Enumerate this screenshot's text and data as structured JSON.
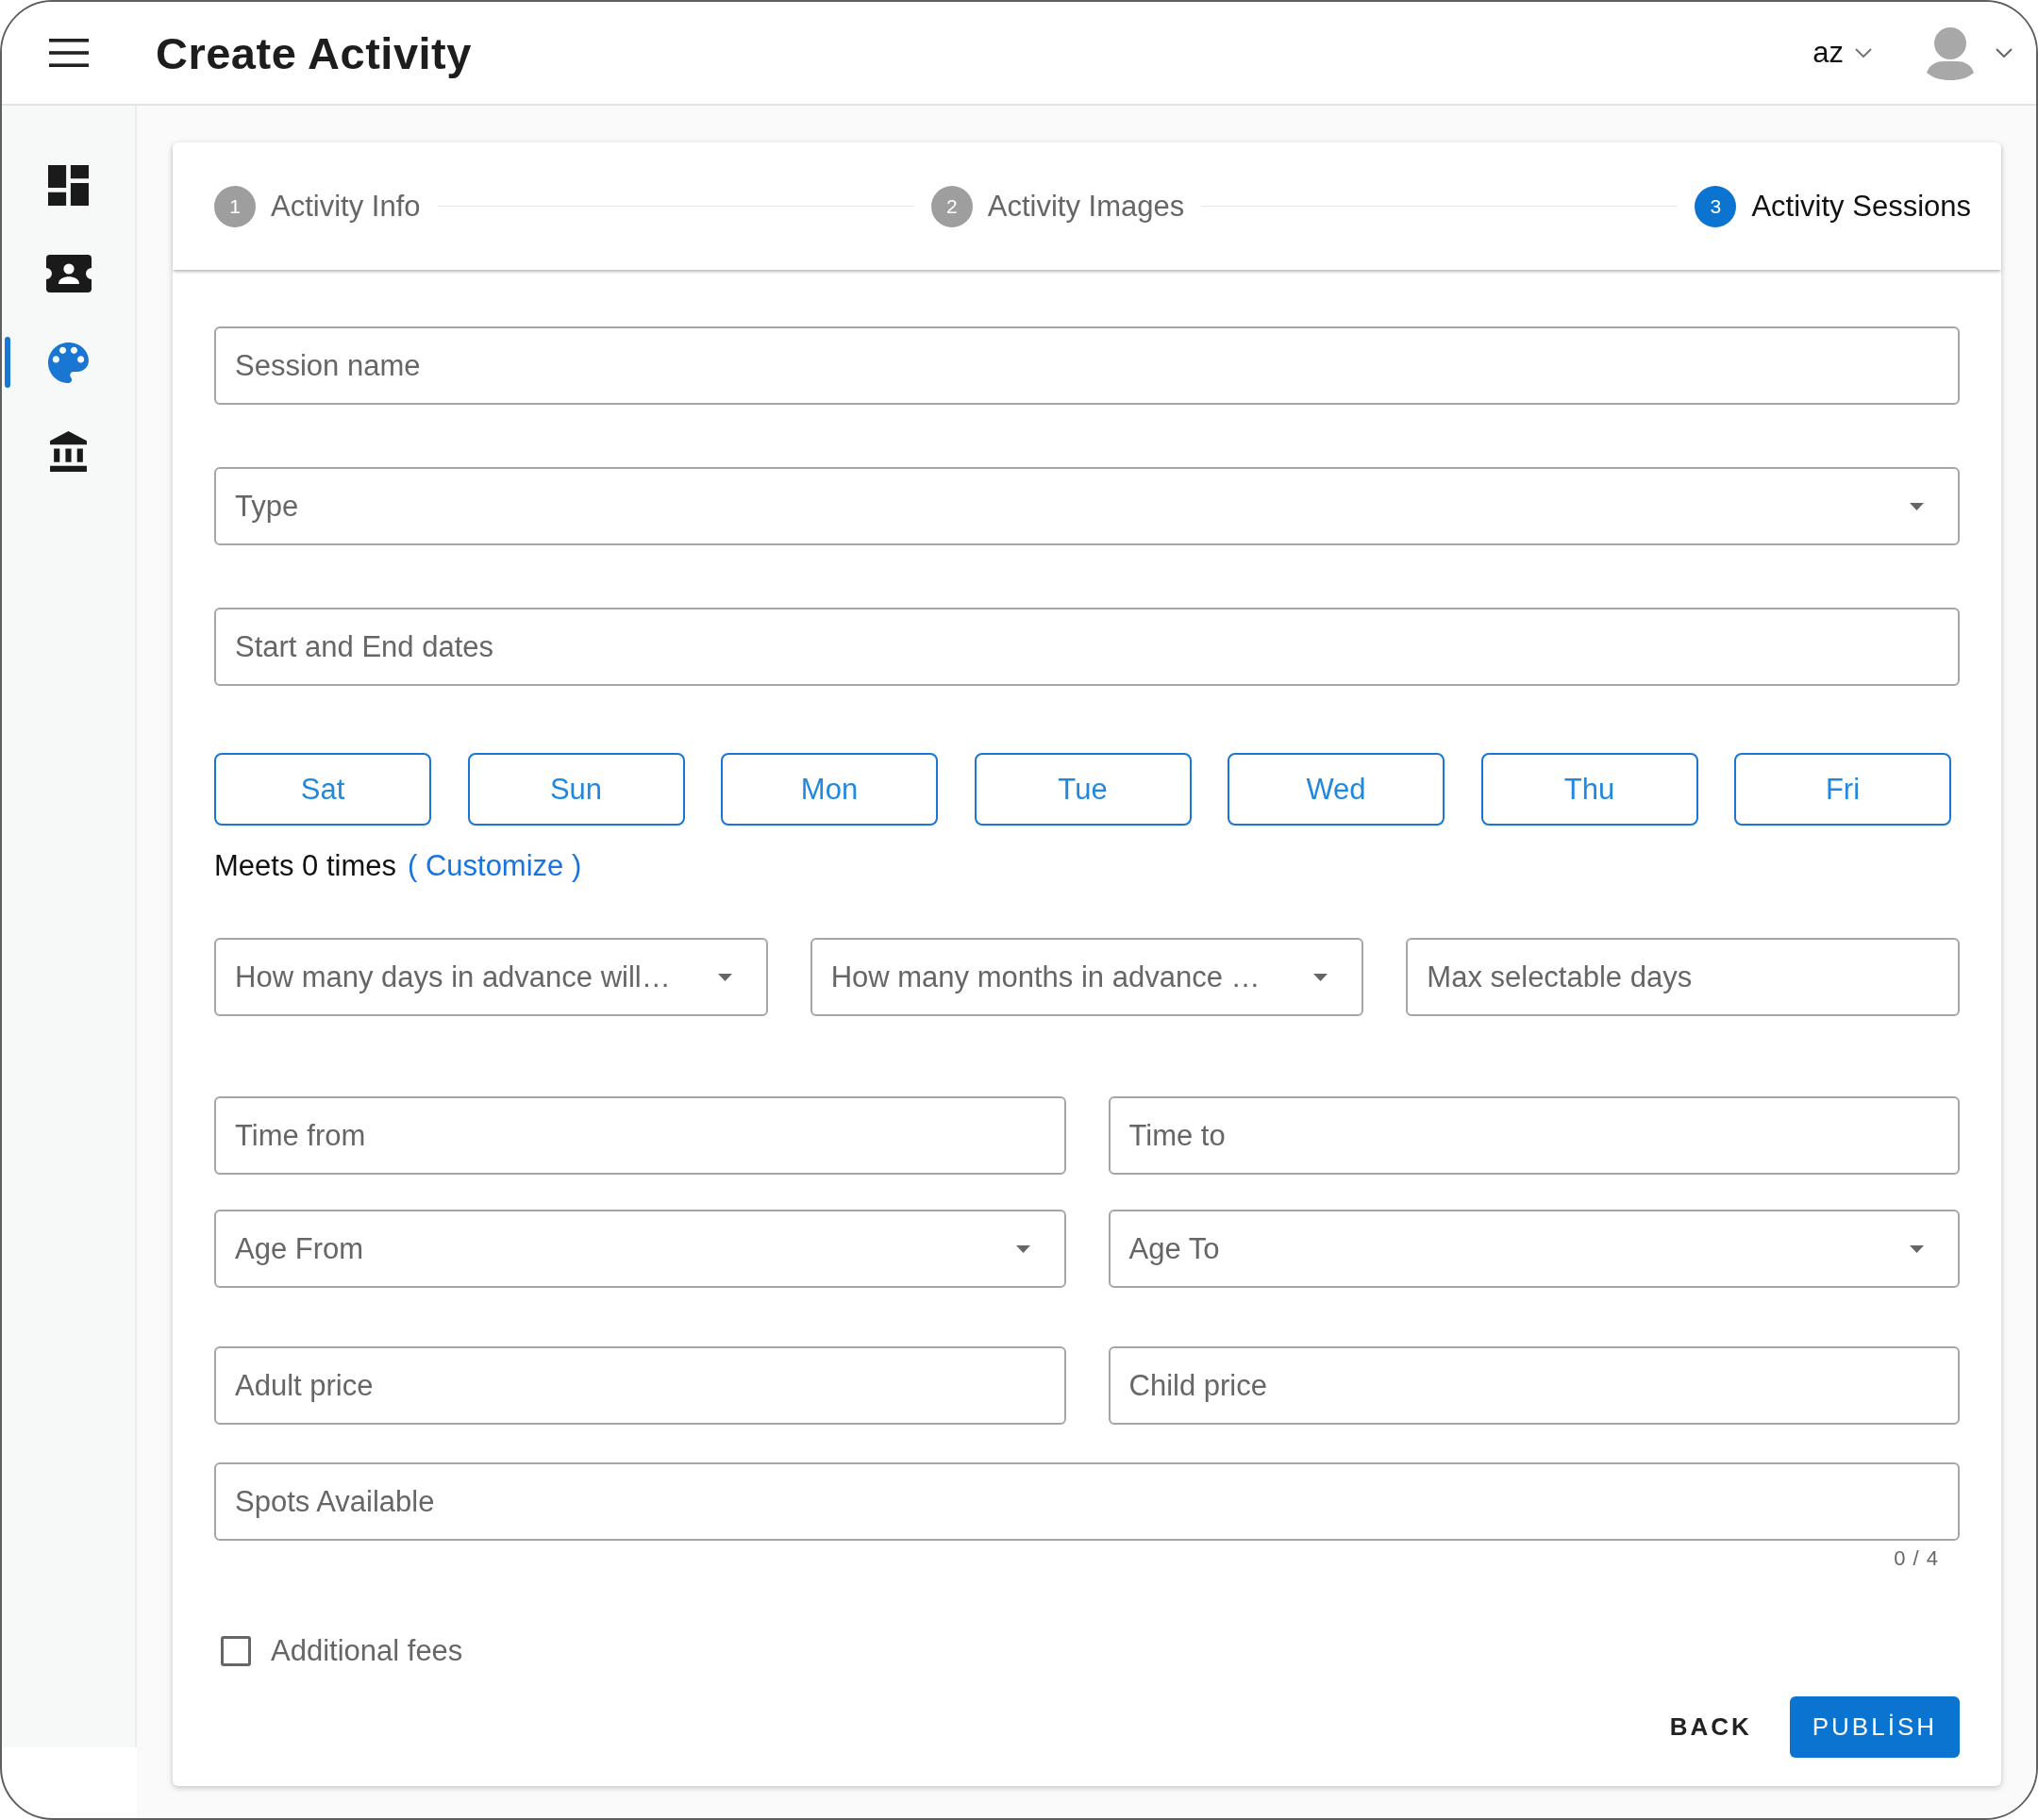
{
  "header": {
    "title": "Create Activity",
    "language": "az"
  },
  "sidebar": {
    "items": [
      {
        "selected": false
      },
      {
        "selected": false
      },
      {
        "selected": true
      },
      {
        "selected": false
      }
    ]
  },
  "stepper": {
    "steps": [
      {
        "number": "1",
        "label": "Activity Info",
        "selected": false
      },
      {
        "number": "2",
        "label": "Activity Images",
        "selected": false
      },
      {
        "number": "3",
        "label": "Activity Sessions",
        "selected": true
      }
    ]
  },
  "form": {
    "top_fields": [
      {
        "kind": "input",
        "placeholder": "Session name"
      },
      {
        "kind": "select",
        "placeholder": "Type"
      },
      {
        "kind": "input",
        "placeholder": "Start and End dates"
      }
    ],
    "weekdays": [
      {
        "label": "Sat",
        "selected": false
      },
      {
        "label": "Sun",
        "selected": false
      },
      {
        "label": "Mon",
        "selected": false
      },
      {
        "label": "Tue",
        "selected": false
      },
      {
        "label": "Wed",
        "selected": false
      },
      {
        "label": "Thu",
        "selected": false
      },
      {
        "label": "Fri",
        "selected": false
      }
    ],
    "meets": {
      "text": "Meets 0 times",
      "link": "( Customize )"
    },
    "field_rows": [
      [
        {
          "kind": "select",
          "placeholder": "How many days in advance will…"
        },
        {
          "kind": "select",
          "placeholder": "How many months in advance …"
        },
        {
          "kind": "input",
          "placeholder": "Max selectable days"
        }
      ],
      [
        {
          "kind": "input",
          "placeholder": "Time from"
        },
        {
          "kind": "input",
          "placeholder": "Time to"
        }
      ],
      [
        {
          "kind": "select",
          "placeholder": "Age From"
        },
        {
          "kind": "select",
          "placeholder": "Age To"
        }
      ],
      [
        {
          "kind": "input",
          "placeholder": "Adult price"
        },
        {
          "kind": "input",
          "placeholder": "Child price"
        }
      ]
    ],
    "spots": {
      "kind": "input",
      "placeholder": "Spots Available",
      "counter": "0 / 4"
    },
    "additional_fees": {
      "label": "Additional fees",
      "checked": false
    },
    "actions": [
      {
        "kind": "text",
        "label": "BACK"
      },
      {
        "kind": "primary",
        "label": "PUBLİSH"
      }
    ]
  }
}
